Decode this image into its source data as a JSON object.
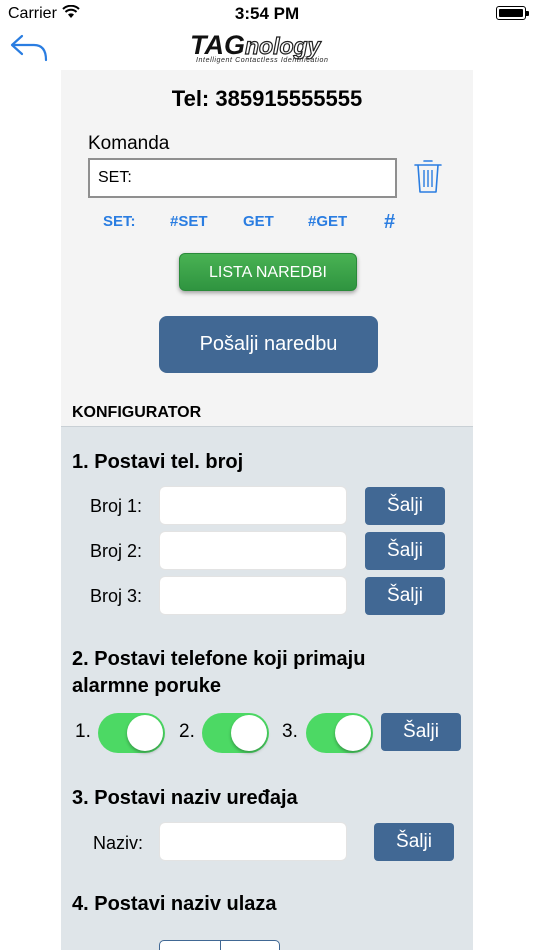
{
  "status_bar": {
    "carrier": "Carrier",
    "time": "3:54 PM"
  },
  "nav": {
    "logo_main": "TAG",
    "logo_tail": "nology",
    "logo_tagline": "Intelligent Contactless Identification"
  },
  "header": {
    "phone": "Tel: 385915555555"
  },
  "command": {
    "label": "Komanda",
    "value": "SET:",
    "quick": [
      "SET:",
      "#SET",
      "GET",
      "#GET",
      "#"
    ]
  },
  "buttons": {
    "lista": "LISTA NAREDBI",
    "posalji": "Pošalji naredbu",
    "salji": "Šalji"
  },
  "configurator": {
    "title": "KONFIGURATOR",
    "section1": {
      "title": "1. Postavi tel. broj",
      "rows": [
        "Broj 1:",
        "Broj 2:",
        "Broj 3:"
      ]
    },
    "section2": {
      "title_line1": "2. Postavi telefone koji primaju",
      "title_line2": "alarmne poruke",
      "switches": [
        "1.",
        "2.",
        "3."
      ],
      "states": [
        true,
        true,
        true
      ]
    },
    "section3": {
      "title": "3. Postavi naziv uređaja",
      "label": "Naziv:"
    },
    "section4": {
      "title": "4. Postavi naziv ulaza"
    }
  },
  "colors": {
    "accent_blue": "#416894",
    "link_blue": "#2a7de1",
    "green": "#4cd964",
    "panel_bg": "#dfe5e9"
  }
}
